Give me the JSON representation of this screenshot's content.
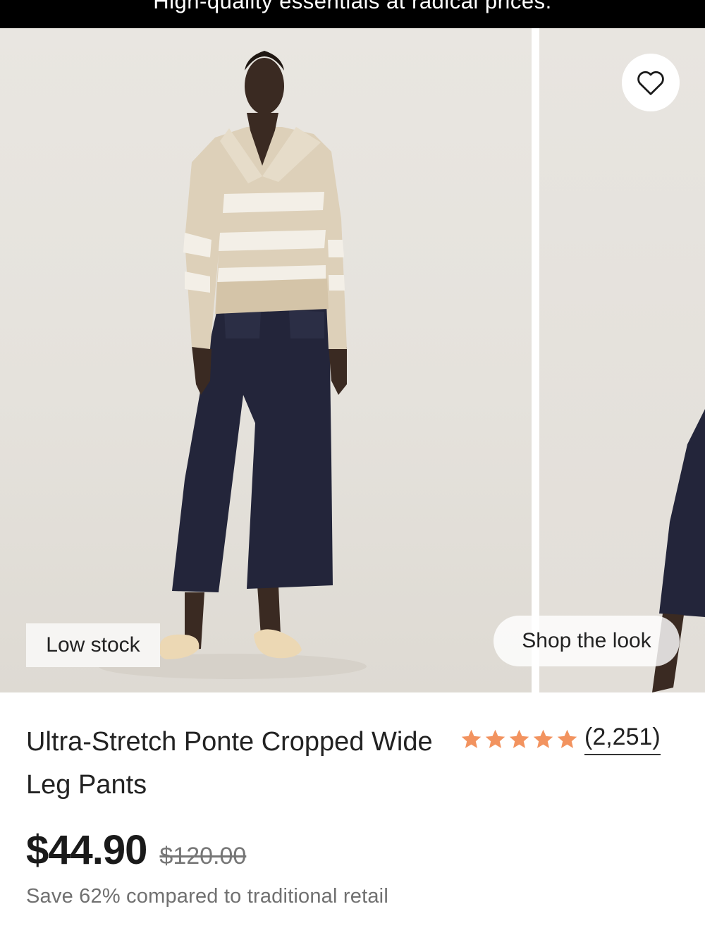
{
  "promo": {
    "text": "High-quality essentials at radical prices."
  },
  "gallery": {
    "badge": "Low stock",
    "shop_look": "Shop the look",
    "favorite_icon": "heart-outline-icon"
  },
  "product": {
    "title": "Ultra-Stretch Ponte Cropped Wide Leg Pants",
    "rating": {
      "stars": 5,
      "count_label": "(2,251)",
      "star_color": "#f2935f"
    },
    "price": {
      "current": "$44.90",
      "original": "$120.00"
    },
    "savings": "Save 62% compared to traditional retail"
  }
}
